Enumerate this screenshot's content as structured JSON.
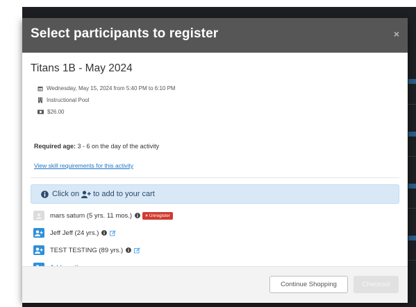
{
  "modal": {
    "title": "Select participants to register",
    "close_glyph": "×"
  },
  "activity": {
    "name": "Titans 1B - May 2024",
    "schedule": "Wednesday, May 15, 2024 from 5:40 PM to 6:10 PM",
    "location": "Instructional Pool",
    "price": "$26.00",
    "required_age_label": "Required age:",
    "required_age_value": " 3 - 6 on the day of the activity",
    "skill_link": "View skill requirements for this activity",
    "icons": {
      "schedule": "calendar-icon",
      "location": "building-icon",
      "price": "money-icon"
    }
  },
  "banner": {
    "prefix": "Click on",
    "suffix": "to add to your cart",
    "icons": {
      "lead": "info-circle-icon",
      "add": "user-plus-icon"
    }
  },
  "participants": [
    {
      "name": "mars saturn (5 yrs. 11 mos.)",
      "action": "Unregister",
      "action_glyph": "×"
    },
    {
      "name": "Jeff Jeff (24 yrs.)"
    },
    {
      "name": "TEST TESTING (89 yrs.)"
    }
  ],
  "add_person": "Add another person",
  "footer": {
    "continue_label": "Continue Shopping",
    "checkout_label": "Checkout"
  },
  "colors": {
    "header": "#565656",
    "link": "#1a73c9",
    "avatar_blue": "#2f8fd8",
    "unregister_red": "#d13b31",
    "banner_bg": "#d8e8f6"
  }
}
